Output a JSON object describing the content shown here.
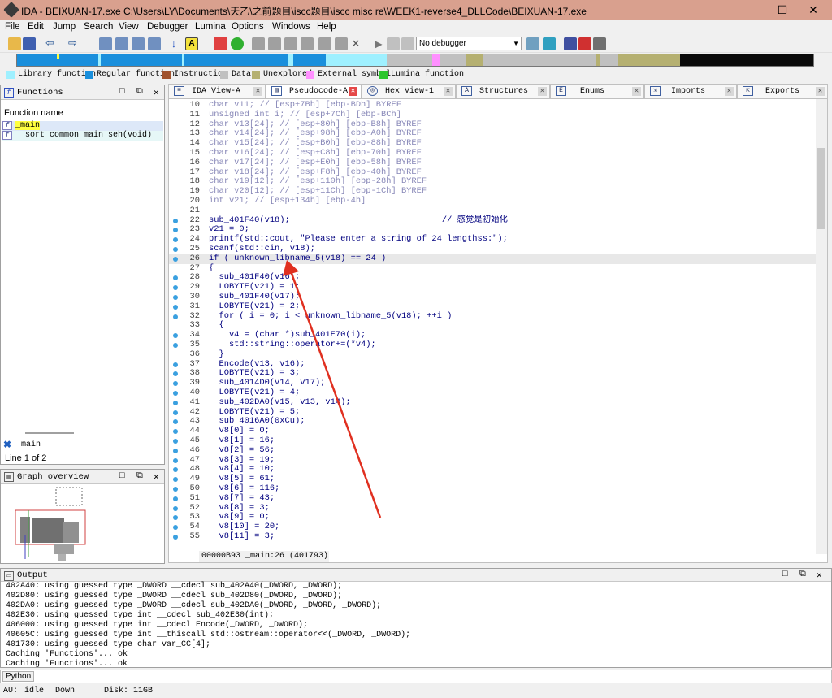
{
  "window": {
    "title": "IDA - BEIXUAN-17.exe C:\\Users\\LY\\Documents\\天乙\\之前题目\\iscc题目\\iscc misc re\\WEEK1-reverse4_DLLCode\\BEIXUAN-17.exe",
    "minimize": "—",
    "maximize": "☐",
    "close": "✕"
  },
  "menu": [
    "File",
    "Edit",
    "Jump",
    "Search",
    "View",
    "Debugger",
    "Lumina",
    "Options",
    "Windows",
    "Help"
  ],
  "toolbar": {
    "debugger": "No debugger"
  },
  "legend": [
    "Library function",
    "Regular function",
    "Instruction",
    "Data",
    "Unexplored",
    "External symbol",
    "Lumina function"
  ],
  "colors": {
    "library": "#9ff0ff",
    "regular": "#1a8fdc",
    "instruction": "#a0522d",
    "data": "#c0c0c0",
    "unexplored": "#b5b071",
    "external": "#ff90ff",
    "lumina": "#2ec62e",
    "breakpoint_dot": "#3aa0e0",
    "highlight": "#ffff40"
  },
  "functions_panel": {
    "title": "Functions",
    "column": "Function name",
    "items": [
      "_main",
      "__sort_common_main_seh(void)"
    ],
    "search": "main",
    "line_count": "Line 1 of 2"
  },
  "graph_panel": {
    "title": "Graph overview"
  },
  "tabs": [
    "IDA View-A",
    "Pseudocode-A",
    "Hex View-1",
    "Structures",
    "Enums",
    "Imports",
    "Exports"
  ],
  "code_lines": [
    {
      "n": "10",
      "t": "char v11; // [esp+7Bh] [ebp-BDh] BYREF",
      "dot": false
    },
    {
      "n": "11",
      "t": "unsigned int i; // [esp+7Ch] [ebp-BCh]",
      "dot": false
    },
    {
      "n": "12",
      "t": "char v13[24]; // [esp+80h] [ebp-B8h] BYREF",
      "dot": false
    },
    {
      "n": "13",
      "t": "char v14[24]; // [esp+98h] [ebp-A0h] BYREF",
      "dot": false
    },
    {
      "n": "14",
      "t": "char v15[24]; // [esp+B0h] [ebp-88h] BYREF",
      "dot": false
    },
    {
      "n": "15",
      "t": "char v16[24]; // [esp+C8h] [ebp-70h] BYREF",
      "dot": false
    },
    {
      "n": "16",
      "t": "char v17[24]; // [esp+E0h] [ebp-58h] BYREF",
      "dot": false
    },
    {
      "n": "17",
      "t": "char v18[24]; // [esp+F8h] [ebp-40h] BYREF",
      "dot": false
    },
    {
      "n": "18",
      "t": "char v19[12]; // [esp+110h] [ebp-28h] BYREF",
      "dot": false
    },
    {
      "n": "19",
      "t": "char v20[12]; // [esp+11Ch] [ebp-1Ch] BYREF",
      "dot": false
    },
    {
      "n": "20",
      "t": "int v21; // [esp+134h] [ebp-4h]",
      "dot": false
    },
    {
      "n": "21",
      "t": "",
      "dot": false
    },
    {
      "n": "22",
      "t": "sub_401F40(v18);                              // 感觉是初始化",
      "dot": true
    },
    {
      "n": "23",
      "t": "v21 = 0;",
      "dot": true
    },
    {
      "n": "24",
      "t": "printf(std::cout, \"Please enter a string of 24 lengthss:\");",
      "dot": true
    },
    {
      "n": "25",
      "t": "scanf(std::cin, v18);",
      "dot": true
    },
    {
      "n": "26",
      "t": "if ( unknown_libname_5(v18) == 24 )",
      "dot": true
    },
    {
      "n": "27",
      "t": "{",
      "dot": false
    },
    {
      "n": "28",
      "t": "  sub_401F40(v16);",
      "dot": true
    },
    {
      "n": "29",
      "t": "  LOBYTE(v21) = 1;",
      "dot": true
    },
    {
      "n": "30",
      "t": "  sub_401F40(v17);",
      "dot": true
    },
    {
      "n": "31",
      "t": "  LOBYTE(v21) = 2;",
      "dot": true
    },
    {
      "n": "32",
      "t": "  for ( i = 0; i < unknown_libname_5(v18); ++i )",
      "dot": true
    },
    {
      "n": "33",
      "t": "  {",
      "dot": false
    },
    {
      "n": "34",
      "t": "    v4 = (char *)sub_401E70(i);",
      "dot": true
    },
    {
      "n": "35",
      "t": "    std::string::operator+=(*v4);",
      "dot": true
    },
    {
      "n": "36",
      "t": "  }",
      "dot": false
    },
    {
      "n": "37",
      "t": "  Encode(v13, v16);",
      "dot": true
    },
    {
      "n": "38",
      "t": "  LOBYTE(v21) = 3;",
      "dot": true
    },
    {
      "n": "39",
      "t": "  sub_4014D0(v14, v17);",
      "dot": true
    },
    {
      "n": "40",
      "t": "  LOBYTE(v21) = 4;",
      "dot": true
    },
    {
      "n": "41",
      "t": "  sub_402DA0(v15, v13, v14);",
      "dot": true
    },
    {
      "n": "42",
      "t": "  LOBYTE(v21) = 5;",
      "dot": true
    },
    {
      "n": "43",
      "t": "  sub_4016A0(0xCu);",
      "dot": true
    },
    {
      "n": "44",
      "t": "  v8[0] = 0;",
      "dot": true
    },
    {
      "n": "45",
      "t": "  v8[1] = 16;",
      "dot": true
    },
    {
      "n": "46",
      "t": "  v8[2] = 56;",
      "dot": true
    },
    {
      "n": "47",
      "t": "  v8[3] = 19;",
      "dot": true
    },
    {
      "n": "48",
      "t": "  v8[4] = 10;",
      "dot": true
    },
    {
      "n": "49",
      "t": "  v8[5] = 61;",
      "dot": true
    },
    {
      "n": "50",
      "t": "  v8[6] = 116;",
      "dot": true
    },
    {
      "n": "51",
      "t": "  v8[7] = 43;",
      "dot": true
    },
    {
      "n": "52",
      "t": "  v8[8] = 3;",
      "dot": true
    },
    {
      "n": "53",
      "t": "  v8[9] = 0;",
      "dot": true
    },
    {
      "n": "54",
      "t": "  v8[10] = 20;",
      "dot": true
    },
    {
      "n": "55",
      "t": "  v8[11] = 3;",
      "dot": true
    }
  ],
  "code_status": "00000B93 _main:26 (401793)",
  "output": {
    "title": "Output",
    "lines": [
      "402A40: using guessed type _DWORD __cdecl sub_402A40(_DWORD, _DWORD);",
      "402D80: using guessed type _DWORD __cdecl sub_402D80(_DWORD, _DWORD);",
      "402DA0: using guessed type _DWORD __cdecl sub_402DA0(_DWORD, _DWORD, _DWORD);",
      "402E30: using guessed type int __cdecl sub_402E30(int);",
      "406000: using guessed type int __cdecl Encode(_DWORD, _DWORD);",
      "40605C: using guessed type int __thiscall std::ostream::operator<<(_DWORD, _DWORD);",
      "401730: using guessed type char var_CC[4];",
      "Caching 'Functions'... ok",
      "Caching 'Functions'... ok"
    ]
  },
  "python_label": "Python",
  "status": {
    "au": "AU:",
    "state": "idle",
    "dir": "Down",
    "disk": "Disk: 11GB"
  }
}
